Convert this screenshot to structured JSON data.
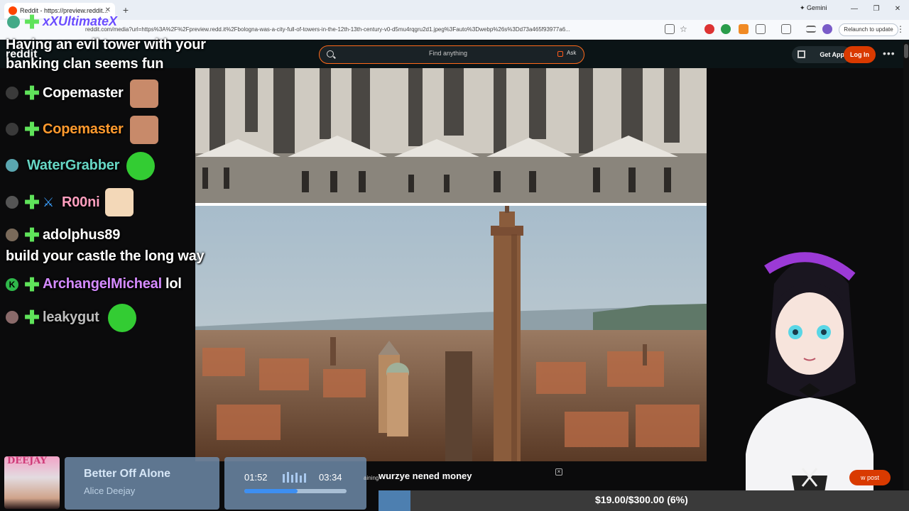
{
  "browser": {
    "tab_title": "Reddit - https://preview.reddit...",
    "new_tab": "+",
    "gemini_label": "Gemini",
    "url": "reddit.com/media?url=https%3A%2F%2Fpreview.redd.it%2Fbologna-was-a-city-full-of-towers-in-the-12th-13th-century-v0-d5mu4rqgru2d1.jpeg%3Fauto%3Dwebp%26s%3Dd73a465f93977a6...",
    "relaunch_label": "Relaunch to update"
  },
  "reddit": {
    "search_placeholder": "Find anything",
    "ask_label": "Ask",
    "get_app_label": "Get App",
    "login_label": "Log In",
    "post_label": "w post"
  },
  "stream_overlay": {
    "channel_name": "xXUltimateX",
    "reddit_label": "reddit",
    "chat": [
      {
        "user": "",
        "message": "Having an evil tower with your banking clan seems fun",
        "user_color": "#ffffff"
      },
      {
        "user": "Copemaster",
        "message": "",
        "user_color": "#ffffff"
      },
      {
        "user": "Copemaster",
        "message": "",
        "user_color": "#ff9a2e"
      },
      {
        "user": "WaterGrabber",
        "message": "",
        "user_color": "#66d6c4"
      },
      {
        "user": "R00ni",
        "message": "",
        "user_color": "#ff9fbf"
      },
      {
        "user": "adolphus89",
        "message": "build your castle the long way",
        "user_color": "#ffffff"
      },
      {
        "user": "ArchangelMicheal",
        "message": "lol",
        "user_color": "#d58bff"
      },
      {
        "user": "leakygut",
        "message": "",
        "user_color": "#bdbdbd"
      }
    ],
    "now_playing": {
      "album_text": "DEEJAY",
      "title": "Better Off Alone",
      "artist": "Alice Deejay",
      "current_time": "01:52",
      "total_time": "03:34",
      "progress": 0.52
    },
    "ticker_text": "wurzye nened money",
    "ticker_small": "aining",
    "goal_text": "$19.00/$300.00 (6%)",
    "goal_progress": 0.06
  },
  "icons": [
    "reddit-favicon",
    "search-icon",
    "ask-icon",
    "qr-icon",
    "more-icon",
    "tab-close-icon",
    "star-icon",
    "extension-icon",
    "profile-icon"
  ],
  "colors": {
    "reddit_orange": "#d93a00",
    "accent": "#ff6a1a",
    "goal_fill": "#4d7fb0"
  }
}
